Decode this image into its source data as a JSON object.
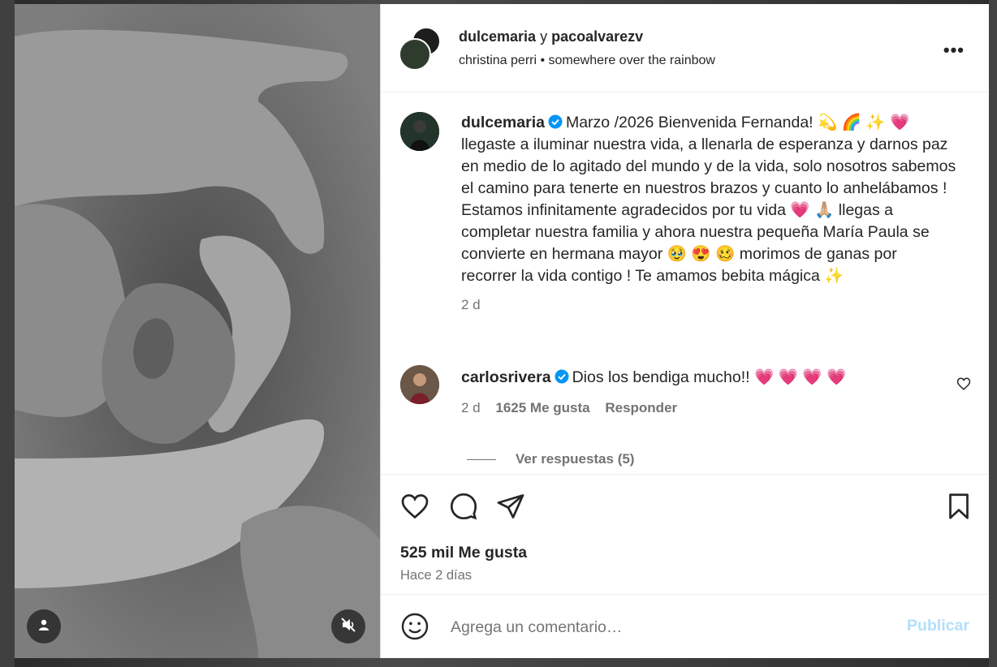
{
  "header": {
    "user1": "dulcemaria",
    "conj": "y",
    "user2": "pacoalvarezv",
    "music": "christina perri • somewhere over the rainbow",
    "more_label": "•••"
  },
  "caption": {
    "username": "dulcemaria",
    "text": "Marzo /2026 Bienvenida Fernanda! 💫 🌈 ✨ 💗 llegaste a iluminar nuestra vida, a llenarla de esperanza y darnos paz en medio de lo agitado del mundo y de la vida, solo nosotros sabemos el camino para tenerte en nuestros brazos y cuanto lo anhelábamos ! Estamos infinitamente agradecidos por tu vida 💗 🙏🏼 llegas a completar nuestra familia y ahora nuestra pequeña María Paula se convierte en hermana mayor 🥹 😍 🥴 morimos de ganas por recorrer la vida contigo ! Te amamos bebita mágica ✨",
    "time": "2 d"
  },
  "comment": {
    "username": "carlosrivera",
    "text": "Dios los bendiga mucho!! 💗 💗 💗 💗",
    "time": "2 d",
    "likes": "1625 Me gusta",
    "reply": "Responder",
    "view_replies": "Ver respuestas (5)"
  },
  "stats": {
    "likes": "525 mil Me gusta",
    "date": "Hace 2 días"
  },
  "add_comment": {
    "placeholder": "Agrega un comentario…",
    "submit": "Publicar"
  },
  "colors": {
    "verified": "#0095f6",
    "publish_disabled": "#b2dffc",
    "text": "#262626",
    "muted": "#737373"
  },
  "icons": [
    "user-tag-icon",
    "mute-icon",
    "heart-icon",
    "comment-icon",
    "share-icon",
    "bookmark-icon",
    "emoji-icon",
    "more-icon",
    "verified-icon"
  ]
}
